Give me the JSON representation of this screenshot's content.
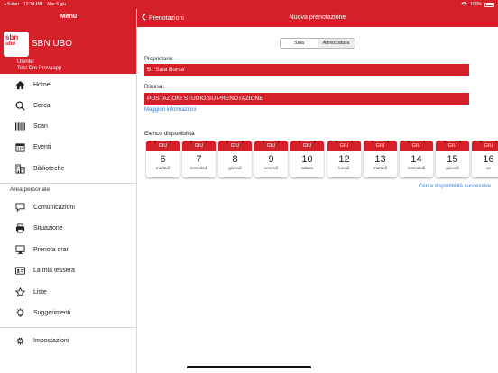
{
  "status": {
    "carrier": "◂ Safari",
    "time": "12:24 PM",
    "date": "Mar 6 giu",
    "battery": "100%",
    "accent": "#d5202a"
  },
  "sidebar": {
    "title": "Menu",
    "logo_text_1": "sbn",
    "logo_text_2": "ubo",
    "app_name": "SBN UBO",
    "user_label": "Utente:",
    "user_name": "Test Dm Provaapp",
    "section_title": "Area personale",
    "items": [
      {
        "label": "Home",
        "icon": "home-icon"
      },
      {
        "label": "Cerca",
        "icon": "search-icon"
      },
      {
        "label": "Scan",
        "icon": "barcode-icon"
      },
      {
        "label": "Eventi",
        "icon": "calendar-icon"
      },
      {
        "label": "Biblioteche",
        "icon": "library-icon"
      },
      {
        "label": "Comunicazioni",
        "icon": "chat-icon"
      },
      {
        "label": "Situazione",
        "icon": "printer-icon"
      },
      {
        "label": "Prenota orari",
        "icon": "pc-icon"
      },
      {
        "label": "La mia tessera",
        "icon": "card-icon"
      },
      {
        "label": "Liste",
        "icon": "star-icon"
      },
      {
        "label": "Suggerimenti",
        "icon": "bulb-icon"
      },
      {
        "label": "Impostazioni",
        "icon": "gear-icon"
      }
    ]
  },
  "main": {
    "back_label": "Prenotazioni",
    "title": "Nuova prenotazione",
    "segments": [
      {
        "label": "Sala",
        "selected": true
      },
      {
        "label": "Attrezzatura",
        "selected": false
      }
    ],
    "owner_label": "Proprietario:",
    "owner_value": "B. 'Sala Borsa'",
    "resource_label": "Risorsa:",
    "resource_value": "POSTAZIONI STUDIO SU PRENOTAZIONE",
    "more_info": "Maggiori informazioni",
    "availability_label": "Elenco disponibilità",
    "next_availability": "Cerca disponibilità successive",
    "days": [
      {
        "month": "GIU",
        "day": "6",
        "weekday": "martedì"
      },
      {
        "month": "GIU",
        "day": "7",
        "weekday": "mercoledì"
      },
      {
        "month": "GIU",
        "day": "8",
        "weekday": "giovedì"
      },
      {
        "month": "GIU",
        "day": "9",
        "weekday": "venerdì"
      },
      {
        "month": "GIU",
        "day": "10",
        "weekday": "sabato"
      },
      {
        "month": "GIU",
        "day": "12",
        "weekday": "lunedì"
      },
      {
        "month": "GIU",
        "day": "13",
        "weekday": "martedì"
      },
      {
        "month": "GIU",
        "day": "14",
        "weekday": "mercoledì"
      },
      {
        "month": "GIU",
        "day": "15",
        "weekday": "giovedì"
      },
      {
        "month": "GIU",
        "day": "16",
        "weekday": "ve"
      }
    ]
  }
}
